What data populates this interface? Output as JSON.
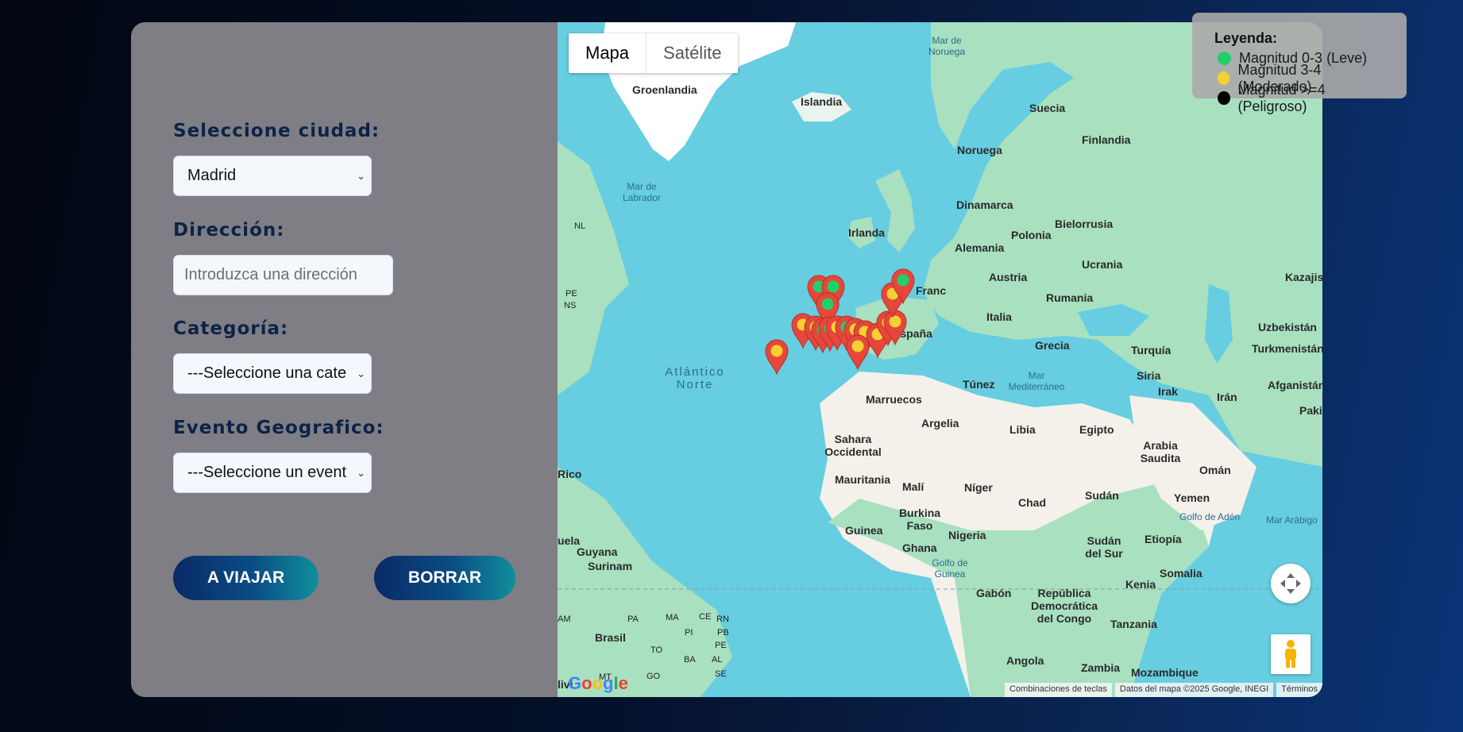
{
  "form": {
    "city_label": "Seleccione ciudad:",
    "city_value": "Madrid",
    "address_label": "Dirección:",
    "address_placeholder": "Introduzca una dirección",
    "category_label": "Categoría:",
    "category_value": "---Seleccione una cate",
    "event_label": "Evento Geografico:",
    "event_value": "---Seleccione un event",
    "travel_button": "A VIAJAR",
    "clear_button": "BORRAR"
  },
  "map": {
    "type_control": {
      "map": "Mapa",
      "satellite": "Satélite"
    },
    "labels": {
      "groenlandia": "Groenlandia",
      "islandia": "Islandia",
      "mar_noruega": "Mar de Noruega",
      "suecia": "Suecia",
      "finlandia": "Finlandia",
      "noruega": "Noruega",
      "mar_labrador": "Mar de Labrador",
      "dinamarca": "Dinamarca",
      "irlanda": "Irlanda",
      "bielorrusia": "Bielorrusia",
      "polonia": "Polonia",
      "alemania": "Alemania",
      "ucrania": "Ucrania",
      "kazajistan": "Kazajist",
      "francia": "Franc",
      "austria": "Austria",
      "rumania": "Rumania",
      "italia": "Italia",
      "espana": "España",
      "uzbekistan": "Uzbekistán",
      "turquia": "Turquía",
      "turkmenistan": "Turkmenistán",
      "grecia": "Grecia",
      "atlantico": "Atlántico Norte",
      "siria": "Siria",
      "afganistan": "Afganistán",
      "tunez": "Túnez",
      "mar_mediterraneo": "Mar Mediterráneo",
      "irak": "Irak",
      "iran": "Irán",
      "pakistan": "Pakis",
      "marruecos": "Marruecos",
      "argelia": "Argelia",
      "libia": "Libia",
      "egipto": "Egipto",
      "sahara": "Sahara Occidental",
      "arabia": "Arabia Saudita",
      "oman": "Omán",
      "rico": "Rico",
      "mauritania": "Mauritania",
      "mali": "Malí",
      "niger": "Níger",
      "chad": "Chad",
      "sudan": "Sudán",
      "yemen": "Yemen",
      "golfo_aden": "Golfo de Adén",
      "mar_arabigo": "Mar Arábigo",
      "burkina": "Burkina Faso",
      "guinea": "Guinea",
      "nigeria": "Nigeria",
      "sudan_sur": "Sudán del Sur",
      "etiopia": "Etiopía",
      "venezuela": "uela",
      "guyana": "Guyana",
      "surinam": "Surinam",
      "ghana": "Ghana",
      "golfo_guinea": "Golfo de Guinea",
      "somalia": "Somalia",
      "gabon": "Gabón",
      "rdc": "República Democrática del Congo",
      "kenia": "Kenia",
      "brasil": "Brasil",
      "tanzania": "Tanzania",
      "angola": "Angola",
      "zambia": "Zambia",
      "mozambique": "Mozambique",
      "bolivia": "livi",
      "nl": "NL",
      "pe": "PE",
      "ns": "NS",
      "am": "AM",
      "pa": "PA",
      "ma": "MA",
      "ce": "CE",
      "rn": "RN",
      "pi": "PI",
      "pb": "PB",
      "to": "TO",
      "pe_br": "PE",
      "al": "AL",
      "ba": "BA",
      "se": "SE",
      "go": "GO",
      "mt": "MT"
    },
    "attribution": {
      "shortcuts": "Combinaciones de teclas",
      "data": "Datos del mapa ©2025 Google, INEGI",
      "terms": "Términos"
    },
    "google_logo": "Google",
    "markers": [
      {
        "level": "leve"
      },
      {
        "level": "leve"
      },
      {
        "level": "leve"
      },
      {
        "level": "moderado"
      },
      {
        "level": "moderado"
      },
      {
        "level": "leve"
      },
      {
        "level": "leve"
      },
      {
        "level": "moderado"
      },
      {
        "level": "leve"
      },
      {
        "level": "moderado"
      },
      {
        "level": "moderado"
      },
      {
        "level": "moderado"
      },
      {
        "level": "moderado"
      },
      {
        "level": "moderado"
      },
      {
        "level": "moderado"
      },
      {
        "level": "leve"
      },
      {
        "level": "moderado"
      },
      {
        "level": "moderado"
      }
    ]
  },
  "legend": {
    "title": "Leyenda:",
    "items": [
      {
        "label": "Magnitud 0-3 (Leve)",
        "color": "#22d06a"
      },
      {
        "label": "Magnitud 3-4 (Moderado)",
        "color": "#f5d032"
      },
      {
        "label": "Magnitud >=4 (Peligroso)",
        "color": "#000000"
      }
    ]
  },
  "colors": {
    "water": "#67cde0",
    "land": "#a8e0c0",
    "desert": "#f3f0e8",
    "marker": "#e7463b"
  }
}
